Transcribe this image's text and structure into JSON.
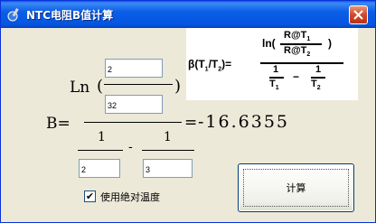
{
  "window": {
    "title": "NTC电阻B值计算"
  },
  "formula_image": {
    "b_lhs": "β(T",
    "sub1": "1",
    "slash": "/T",
    "sub2": "2",
    "close_eq": ")=",
    "ln_open": "ln(",
    "ln_close": ")",
    "r_at": "R@T",
    "one": "1",
    "t": "T",
    "minus": "−"
  },
  "form": {
    "ln_label": "Ln",
    "paren_open": "(",
    "paren_close": ")",
    "b_label": "B=",
    "equals": "=",
    "result": "-16.6355",
    "one": "1",
    "minus": "-",
    "r1_value": "2",
    "r2_value": "32",
    "t1_value": "2",
    "t2_value": "3"
  },
  "checkbox": {
    "label": "使用绝对温度",
    "checked": true,
    "mark": "✔"
  },
  "calc_button": {
    "label": "计算"
  }
}
